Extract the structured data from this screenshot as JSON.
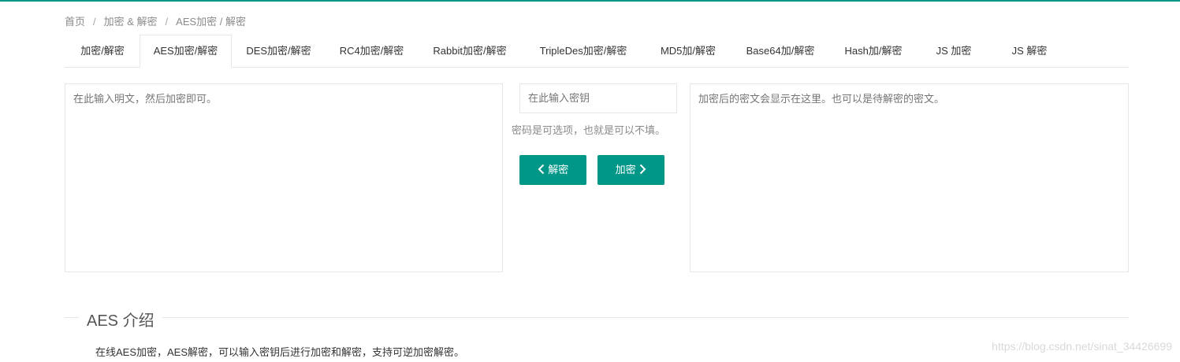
{
  "breadcrumb": {
    "home": "首页",
    "sep": "/",
    "category": "加密 & 解密",
    "current": "AES加密 / 解密"
  },
  "tabs": [
    {
      "label": "加密/解密",
      "active": false
    },
    {
      "label": "AES加密/解密",
      "active": true
    },
    {
      "label": "DES加密/解密",
      "active": false
    },
    {
      "label": "RC4加密/解密",
      "active": false
    },
    {
      "label": "Rabbit加密/解密",
      "active": false
    },
    {
      "label": "TripleDes加密/解密",
      "active": false
    },
    {
      "label": "MD5加/解密",
      "active": false
    },
    {
      "label": "Base64加/解密",
      "active": false
    },
    {
      "label": "Hash加/解密",
      "active": false
    },
    {
      "label": "JS 加密",
      "active": false
    },
    {
      "label": "JS 解密",
      "active": false
    }
  ],
  "plaintext": {
    "placeholder": "在此输入明文，然后加密即可。"
  },
  "key": {
    "placeholder": "在此输入密钥",
    "hint": "密码是可选项，也就是可以不填。"
  },
  "buttons": {
    "decrypt": "解密",
    "encrypt": "加密"
  },
  "ciphertext": {
    "placeholder": "加密后的密文会显示在这里。也可以是待解密的密文。"
  },
  "section": {
    "title": "AES 介绍",
    "text": "在线AES加密，AES解密，可以输入密钥后进行加密和解密，支持可逆加密解密。"
  },
  "watermark": "https://blog.csdn.net/sinat_34426699",
  "colors": {
    "accent": "#009688",
    "border": "#e6e6e6"
  }
}
